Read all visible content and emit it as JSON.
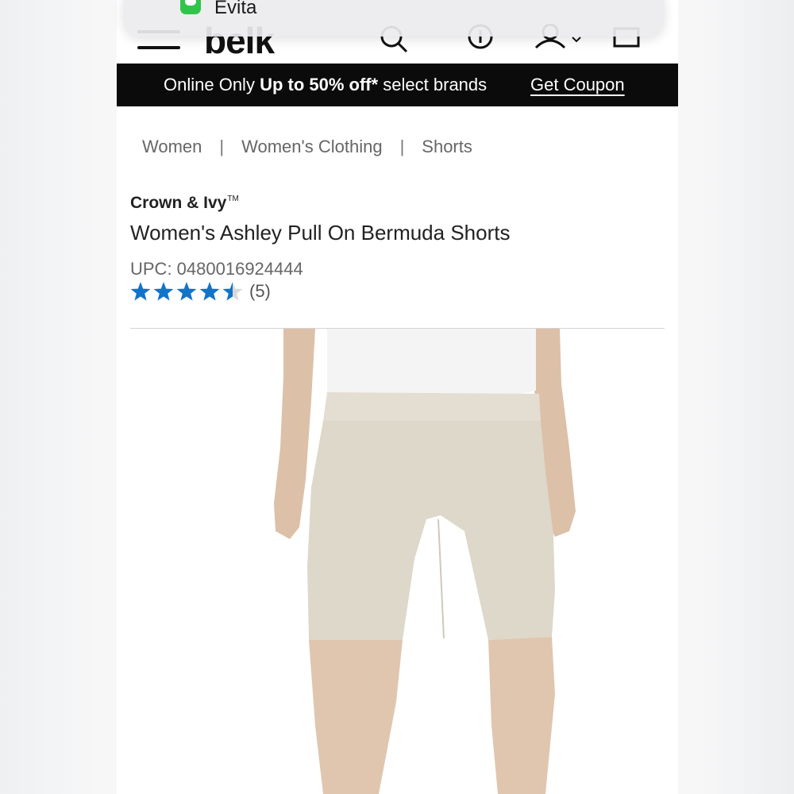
{
  "notification": {
    "title": "Evita"
  },
  "header": {
    "logo": "belk",
    "icons": [
      "menu-icon",
      "search-icon",
      "location-icon",
      "account-icon",
      "chevron-down-icon",
      "bag-icon"
    ]
  },
  "promo": {
    "prefix": "Online Only ",
    "highlight": "Up to 50% off*",
    "suffix": " select brands",
    "link_label": "Get Coupon"
  },
  "breadcrumb": {
    "items": [
      "Women",
      "Women's Clothing",
      "Shorts"
    ],
    "separator": "|"
  },
  "product": {
    "brand": "Crown & Ivy",
    "brand_mark": "TM",
    "title": "Women's Ashley Pull On Bermuda Shorts",
    "upc": "UPC: 0480016924444",
    "rating": 4.5,
    "rating_max": 5,
    "review_count": "(5)"
  },
  "colors": {
    "star_filled": "#1273c9",
    "star_empty": "#d9d9d9",
    "promo_bg": "#0b0b0b",
    "shorts": "#ddd8c9"
  }
}
